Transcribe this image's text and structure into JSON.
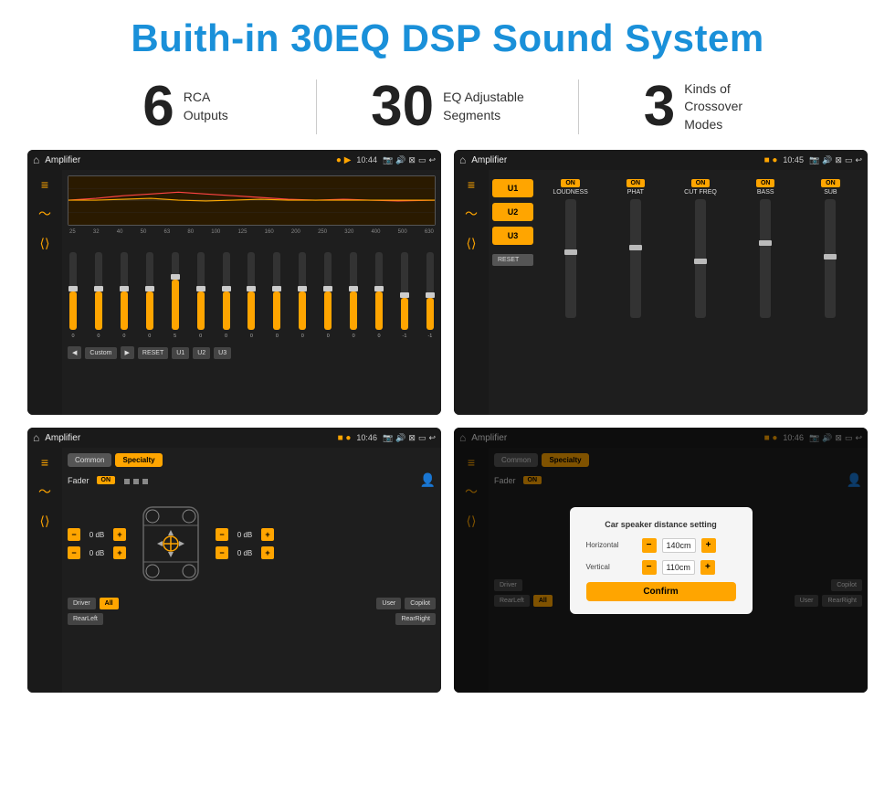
{
  "page": {
    "title": "Buith-in 30EQ DSP Sound System"
  },
  "stats": [
    {
      "number": "6",
      "label": "RCA\nOutputs"
    },
    {
      "number": "30",
      "label": "EQ Adjustable\nSegments"
    },
    {
      "number": "3",
      "label": "Kinds of\nCrossover Modes"
    }
  ],
  "screens": [
    {
      "id": "eq-screen",
      "status_bar": {
        "home": "⌂",
        "title": "Amplifier",
        "dots": "● ▶",
        "time": "10:44",
        "icons": "📷 🔊 ⊠ ▭ ↩"
      },
      "type": "equalizer"
    },
    {
      "id": "amp-screen",
      "status_bar": {
        "home": "⌂",
        "title": "Amplifier",
        "dots": "■ ●",
        "time": "10:45",
        "icons": "📷 🔊 ⊠ ▭ ↩"
      },
      "type": "amplifier"
    },
    {
      "id": "fader-screen",
      "status_bar": {
        "home": "⌂",
        "title": "Amplifier",
        "dots": "■ ●",
        "time": "10:46",
        "icons": "📷 🔊 ⊠ ▭ ↩"
      },
      "type": "fader"
    },
    {
      "id": "dialog-screen",
      "status_bar": {
        "home": "⌂",
        "title": "Amplifier",
        "dots": "■ ●",
        "time": "10:46",
        "icons": "📷 🔊 ⊠ ▭ ↩"
      },
      "type": "dialog",
      "dialog": {
        "title": "Car speaker distance setting",
        "horizontal_label": "Horizontal",
        "horizontal_value": "140cm",
        "vertical_label": "Vertical",
        "vertical_value": "110cm",
        "confirm_label": "Confirm"
      }
    }
  ],
  "eq": {
    "freqs": [
      "25",
      "32",
      "40",
      "50",
      "63",
      "80",
      "100",
      "125",
      "160",
      "200",
      "250",
      "320",
      "400",
      "500",
      "630"
    ],
    "vals": [
      "0",
      "0",
      "0",
      "0",
      "5",
      "0",
      "0",
      "0",
      "0",
      "0",
      "0",
      "0",
      "0",
      "-1",
      "0",
      "-1"
    ],
    "buttons": [
      "◀",
      "Custom",
      "▶",
      "RESET",
      "U1",
      "U2",
      "U3"
    ]
  },
  "amp": {
    "u_buttons": [
      "U1",
      "U2",
      "U3"
    ],
    "channels": [
      {
        "on": true,
        "name": "LOUDNESS"
      },
      {
        "on": true,
        "name": "PHAT"
      },
      {
        "on": true,
        "name": "CUT FREQ"
      },
      {
        "on": true,
        "name": "BASS"
      },
      {
        "on": true,
        "name": "SUB"
      }
    ],
    "reset_label": "RESET"
  },
  "fader": {
    "tabs": [
      "Common",
      "Specialty"
    ],
    "active_tab": "Specialty",
    "fader_label": "Fader",
    "fader_on": "ON",
    "db_rows": [
      "0 dB",
      "0 dB",
      "0 dB",
      "0 dB"
    ],
    "speaker_buttons": [
      "Driver",
      "All",
      "RearLeft",
      "User",
      "RearRight",
      "Copilot"
    ]
  }
}
